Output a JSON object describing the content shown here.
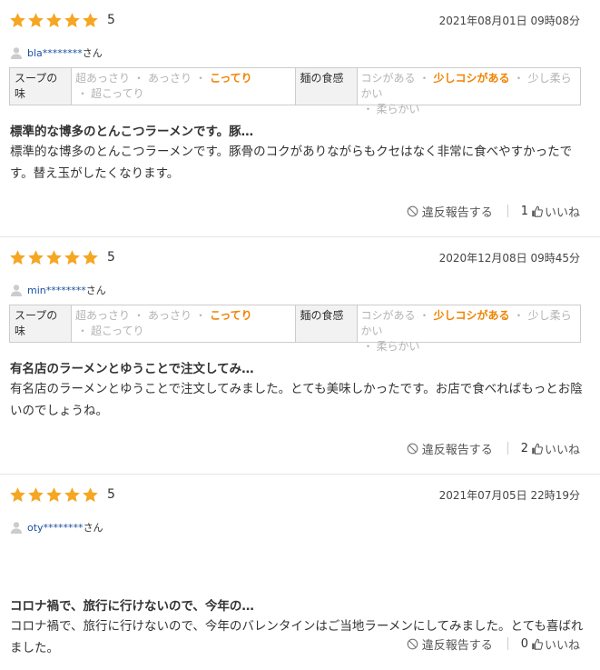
{
  "reviews": [
    {
      "score": "5",
      "date": "2021年08月01日 09時08分",
      "user": "bla********",
      "user_suffix": "さん",
      "attributes": [
        {
          "label": "スープの味",
          "options": [
            "超あっさり",
            "あっさり",
            "こってり",
            "超こってり"
          ],
          "selected": "こってり"
        },
        {
          "label": "麺の食感",
          "options": [
            "コシがある",
            "少しコシがある",
            "少し柔らかい",
            "柔らかい"
          ],
          "selected": "少しコシがある"
        }
      ],
      "title": "標準的な博多のとんこつラーメンです。豚…",
      "body": "標準的な博多のとんこつラーメンです。豚骨のコクがありながらもクセはなく非常に食べやすかったです。替え玉がしたくなります。",
      "report_label": "違反報告する",
      "like_count": "1",
      "like_label": "いいね"
    },
    {
      "score": "5",
      "date": "2020年12月08日 09時45分",
      "user": "min********",
      "user_suffix": "さん",
      "attributes": [
        {
          "label": "スープの味",
          "options": [
            "超あっさり",
            "あっさり",
            "こってり",
            "超こってり"
          ],
          "selected": "こってり"
        },
        {
          "label": "麺の食感",
          "options": [
            "コシがある",
            "少しコシがある",
            "少し柔らかい",
            "柔らかい"
          ],
          "selected": "少しコシがある"
        }
      ],
      "title": "有名店のラーメンとゆうことで注文してみ…",
      "body": "有名店のラーメンとゆうことで注文してみました。とても美味しかったです。お店で食べればもっとお陰いのでしょうね。",
      "report_label": "違反報告する",
      "like_count": "2",
      "like_label": "いいね"
    },
    {
      "score": "5",
      "date": "2021年07月05日 22時19分",
      "user": "oty********",
      "user_suffix": "さん",
      "attributes": [],
      "title": "コロナ禍で、旅行に行けないので、今年の…",
      "body": "コロナ禍で、旅行に行けないので、今年のバレンタインはご当地ラーメンにしてみました。とても喜ばれました。",
      "report_label": "違反報告する",
      "like_count": "0",
      "like_label": "いいね"
    }
  ],
  "colors": {
    "star": "#f5a623",
    "selected_option": "#f08300",
    "unselected_option": "#b3b3b3",
    "user_link": "#1a4fa0",
    "avatar": "#cccccc"
  },
  "icons": {
    "star": "star-icon",
    "avatar": "user-avatar-icon",
    "report": "ban-icon",
    "like": "thumbs-up-icon"
  }
}
